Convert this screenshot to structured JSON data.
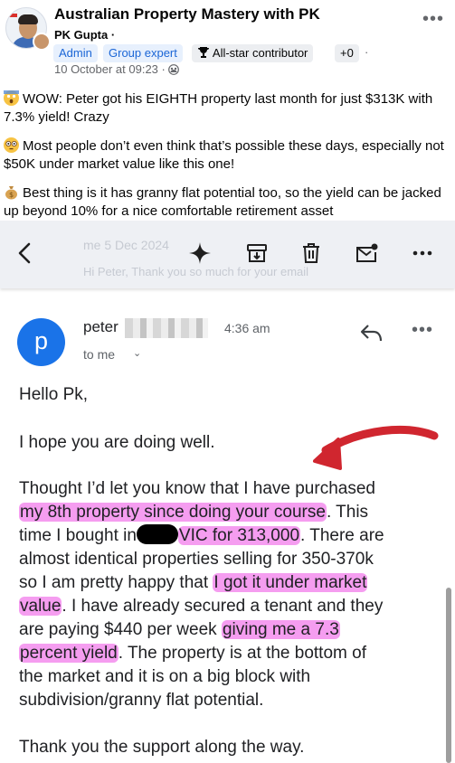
{
  "post": {
    "group_title": "Australian Property Mastery with PK",
    "author": "PK Gupta ·",
    "badges": {
      "admin": "Admin",
      "group_expert": "Group expert",
      "all_star": "All-star contributor",
      "plus": "+0",
      "dot": "·"
    },
    "date": "10 October at 09:23 ·",
    "paragraphs": [
      {
        "emoji": "shocked-face",
        "text": "WOW: Peter got his EIGHTH property last month for just $313K with 7.3% yield! Crazy"
      },
      {
        "emoji": "flushed-face",
        "text": "Most people don’t even think that’s possible these days, especially not $50K under market value like this one!"
      },
      {
        "emoji": "money-bag",
        "text": "Best thing is it has granny flat potential too, so the yield can be jacked up beyond 10% for a nice comfortable retirement asset"
      }
    ]
  },
  "gmail_toolbar": {
    "ghost_line_1": "me  5 Dec 2024",
    "ghost_line_2": "Hi Peter, Thank you so much for your email",
    "icons": [
      "back-arrow-icon",
      "sparkle-icon",
      "archive-icon",
      "trash-icon",
      "mark-unread-icon",
      "more-icon"
    ]
  },
  "email": {
    "avatar_letter": "p",
    "sender": "peter",
    "time": "4:36 am",
    "to": "to me",
    "greeting": "Hello Pk,",
    "line_hope": "I hope you are doing well.",
    "l1": "Thought I’d let you know that I have purchased",
    "l2_hl": "my 8th property since doing your course",
    "l2_rest": ". This",
    "l3_a": "time I bought in",
    "l3_hl": "VIC for 313,000",
    "l3_rest": ". There are",
    "l4": "almost identical properties selling for 350-370k",
    "l5_a": "so I am pretty happy that ",
    "l5_hl": "I got it under market",
    "l6_hl": "value",
    "l6_rest": ". I have already secured a tenant and they",
    "l7_a": "are paying $440 per week ",
    "l7_hl": "giving me a 7.3",
    "l8_hl": "percent yield",
    "l8_rest": ". The property is at the bottom of",
    "l9": "the market and it is on a big block with",
    "l10": "subdivision/granny flat potential.",
    "thanks": "Thank you the support along the way."
  },
  "colors": {
    "highlight": "#f59df0",
    "arrow": "#d0262f",
    "gmail_blue": "#1a73e8",
    "badge_blue": "#1b66d6"
  }
}
